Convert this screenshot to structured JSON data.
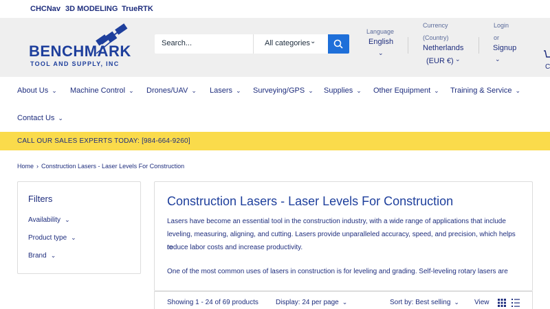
{
  "topbar": {
    "links": [
      "CHCNav",
      "3D MODELING",
      "TrueRTK"
    ]
  },
  "logo": {
    "word": "BENCHMARK",
    "sub": "TOOL AND SUPPLY, INC"
  },
  "search": {
    "placeholder": "Search...",
    "category": "All categories"
  },
  "header": {
    "language_label": "Language",
    "language_value": "English",
    "currency_label": "Currency",
    "currency_label2": "(Country)",
    "currency_value": "Netherlands",
    "currency_value2": "(EUR €)",
    "login_label": "Login",
    "or_label": "or",
    "signup_label": "Signup",
    "cart_label": "C"
  },
  "nav": {
    "items": [
      "About Us",
      "Machine Control",
      "Drones/UAV",
      "Lasers",
      "Surveying/GPS",
      "Supplies",
      "Other Equipment",
      "Training & Service",
      "Contact Us"
    ]
  },
  "promo": {
    "text": "CALL OUR SALES EXPERTS TODAY: [984-664-9260]"
  },
  "breadcrumb": {
    "home": "Home",
    "current": "Construction Lasers - Laser Levels For Construction"
  },
  "filters": {
    "title": "Filters",
    "items": [
      "Availability",
      "Product type",
      "Brand"
    ]
  },
  "main": {
    "title": "Construction Lasers - Laser Levels For Construction",
    "p1_line1": "Lasers have become an essential tool in the construction industry, with a wide range of applications that include",
    "p1_line2": "leveling, measuring, aligning, and cutting. Lasers provide unparalleled accuracy, speed, and precision, which helps to",
    "p1_line3": "reduce labor costs and increase productivity.",
    "p2_line1": "One of the most common uses of lasers in construction is for leveling and grading. Self-leveling rotary lasers are"
  },
  "toolbar": {
    "showing": "Showing 1 - 24 of 69 products",
    "display": "Display: 24 per page",
    "sort": "Sort by: Best selling",
    "view": "View"
  },
  "colors": {
    "brand": "#1e2d7d",
    "accent": "#1e6fd9",
    "promo": "#fadb4b"
  }
}
